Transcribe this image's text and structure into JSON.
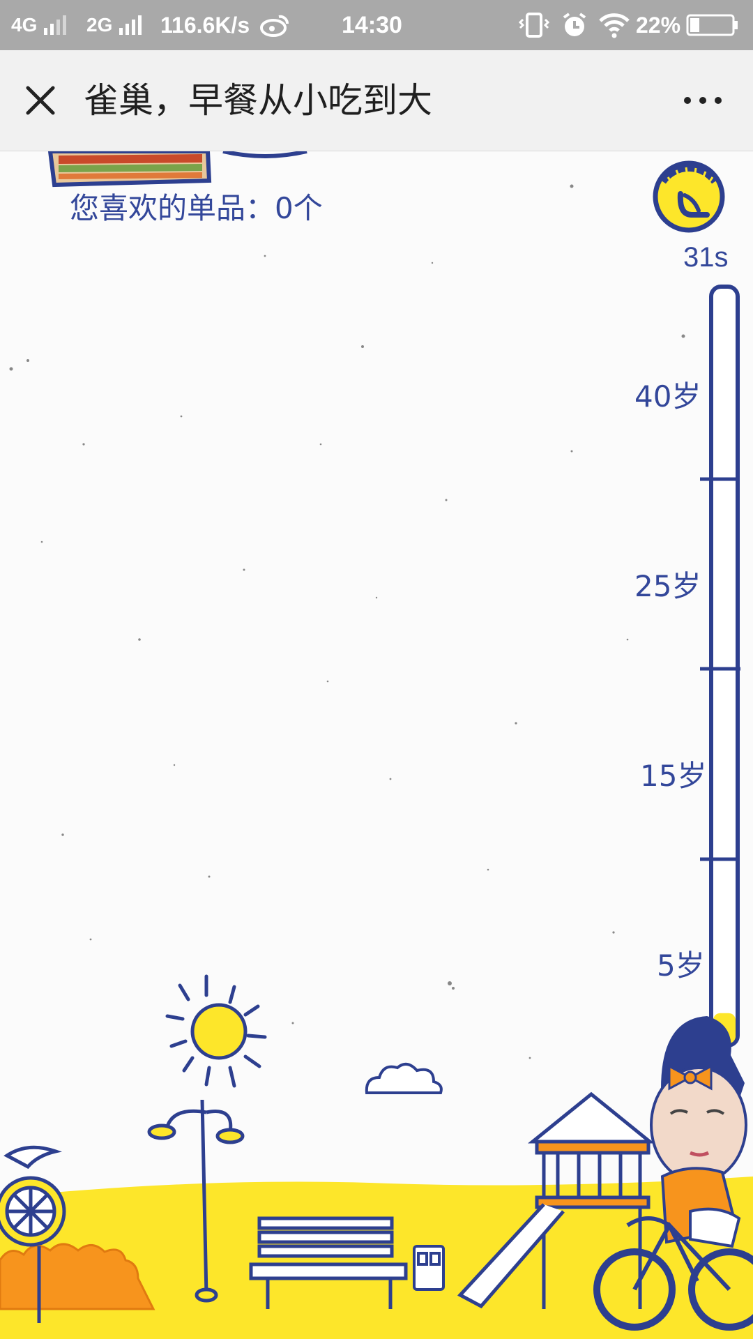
{
  "status_bar": {
    "network1": "4G",
    "network2": "2G",
    "speed": "116.6K/s",
    "time": "14:30",
    "battery": "22%"
  },
  "title_bar": {
    "title": "雀巢，早餐从小吃到大"
  },
  "game": {
    "liked_text": "您喜欢的单品：0个",
    "timer": "31s",
    "progress_fraction": 0.04,
    "age_labels": [
      "40岁",
      "25岁",
      "15岁",
      "5岁"
    ]
  },
  "colors": {
    "brand_blue": "#33479a",
    "yellow": "#fde62a",
    "orange": "#f7941d"
  },
  "icons": [
    "close-icon",
    "more-icon",
    "timer-icon",
    "signal-icon",
    "wifi-icon",
    "alarm-icon",
    "vibrate-icon",
    "battery-icon",
    "weibo-icon"
  ]
}
